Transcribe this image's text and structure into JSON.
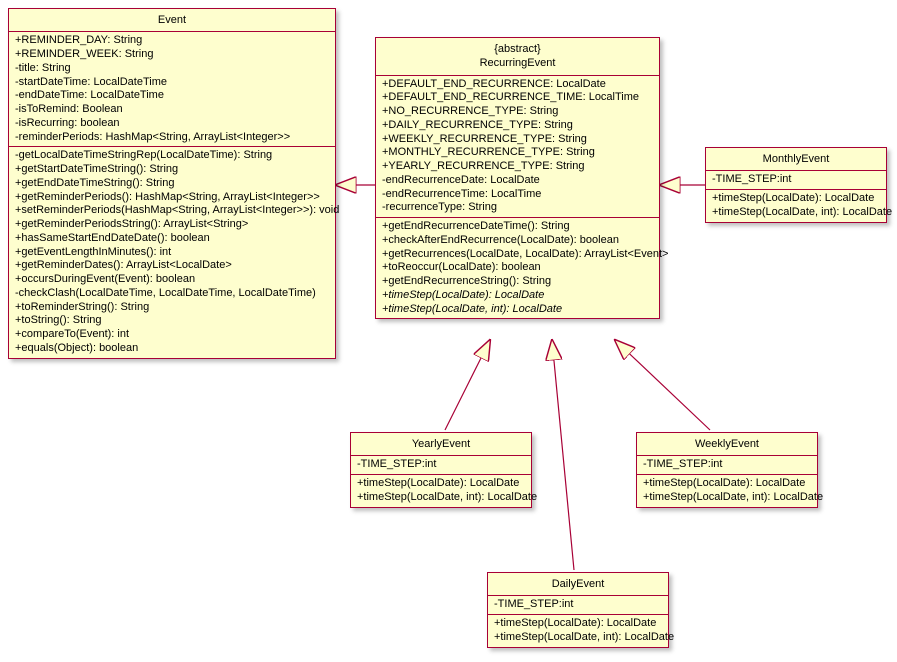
{
  "classes": {
    "event": {
      "name": "Event",
      "fields": [
        "+REMINDER_DAY: String",
        "+REMINDER_WEEK: String",
        "-title: String",
        "-startDateTime: LocalDateTime",
        "-endDateTime: LocalDateTime",
        "-isToRemind: Boolean",
        "-isRecurring: boolean",
        "-reminderPeriods: HashMap<String, ArrayList<Integer>>"
      ],
      "methods": [
        "-getLocalDateTimeStringRep(LocalDateTime): String",
        "+getStartDateTimeString(): String",
        "+getEndDateTimeString(): String",
        "+getReminderPeriods(): HashMap<String, ArrayList<Integer>>",
        "+setReminderPeriods(HashMap<String, ArrayList<Integer>>): void",
        "+getReminderPeriodsString(): ArrayList<String>",
        "+hasSameStartEndDateDate(): boolean",
        "+getEventLengthInMinutes(): int",
        "+getReminderDates(): ArrayList<LocalDate>",
        "+occursDuringEvent(Event): boolean",
        "-checkClash(LocalDateTime, LocalDateTime, LocalDateTime)",
        "+toReminderString(): String",
        "+toString(): String",
        "+compareTo(Event): int",
        "+equals(Object): boolean"
      ]
    },
    "recurring": {
      "stereo": "{abstract}",
      "name": "RecurringEvent",
      "fields": [
        "+DEFAULT_END_RECURRENCE: LocalDate",
        "+DEFAULT_END_RECURRENCE_TIME: LocalTime",
        "+NO_RECURRENCE_TYPE: String",
        "+DAILY_RECURRENCE_TYPE: String",
        "+WEEKLY_RECURRENCE_TYPE: String",
        "+MONTHLY_RECURRENCE_TYPE: String",
        "+YEARLY_RECURRENCE_TYPE: String",
        "-endRecurrenceDate: LocalDate",
        "-endRecurrenceTime: LocalTime",
        "-recurrenceType: String"
      ],
      "methods": [
        {
          "t": "+getEndRecurrenceDateTime(): String",
          "i": false
        },
        {
          "t": "+checkAfterEndRecurrence(LocalDate): boolean",
          "i": false
        },
        {
          "t": "+getRecurrences(LocalDate, LocalDate): ArrayList<Event>",
          "i": false
        },
        {
          "t": "+toReoccur(LocalDate): boolean",
          "i": false
        },
        {
          "t": "+getEndRecurrenceString(): String",
          "i": false
        },
        {
          "t": "+timeStep(LocalDate): LocalDate",
          "i": true
        },
        {
          "t": "+timeStep(LocalDate, int): LocalDate",
          "i": true
        }
      ]
    },
    "monthly": {
      "name": "MonthlyEvent",
      "fields": [
        "-TIME_STEP:int"
      ],
      "methods": [
        "+timeStep(LocalDate): LocalDate",
        "+timeStep(LocalDate, int): LocalDate"
      ]
    },
    "yearly": {
      "name": "YearlyEvent",
      "fields": [
        "-TIME_STEP:int"
      ],
      "methods": [
        "+timeStep(LocalDate): LocalDate",
        "+timeStep(LocalDate, int): LocalDate"
      ]
    },
    "weekly": {
      "name": "WeeklyEvent",
      "fields": [
        "-TIME_STEP:int"
      ],
      "methods": [
        "+timeStep(LocalDate): LocalDate",
        "+timeStep(LocalDate, int): LocalDate"
      ]
    },
    "daily": {
      "name": "DailyEvent",
      "fields": [
        "-TIME_STEP:int"
      ],
      "methods": [
        "+timeStep(LocalDate): LocalDate",
        "+timeStep(LocalDate, int): LocalDate"
      ]
    }
  }
}
